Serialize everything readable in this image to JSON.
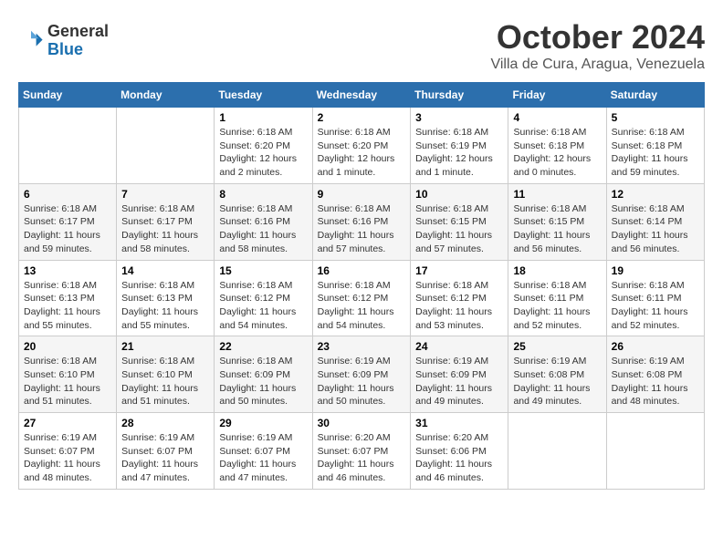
{
  "header": {
    "logo": {
      "general": "General",
      "blue": "Blue"
    },
    "title": "October 2024",
    "location": "Villa de Cura, Aragua, Venezuela"
  },
  "weekdays": [
    "Sunday",
    "Monday",
    "Tuesday",
    "Wednesday",
    "Thursday",
    "Friday",
    "Saturday"
  ],
  "weeks": [
    [
      {
        "day": "",
        "info": ""
      },
      {
        "day": "",
        "info": ""
      },
      {
        "day": "1",
        "info": "Sunrise: 6:18 AM\nSunset: 6:20 PM\nDaylight: 12 hours\nand 2 minutes."
      },
      {
        "day": "2",
        "info": "Sunrise: 6:18 AM\nSunset: 6:20 PM\nDaylight: 12 hours\nand 1 minute."
      },
      {
        "day": "3",
        "info": "Sunrise: 6:18 AM\nSunset: 6:19 PM\nDaylight: 12 hours\nand 1 minute."
      },
      {
        "day": "4",
        "info": "Sunrise: 6:18 AM\nSunset: 6:18 PM\nDaylight: 12 hours\nand 0 minutes."
      },
      {
        "day": "5",
        "info": "Sunrise: 6:18 AM\nSunset: 6:18 PM\nDaylight: 11 hours\nand 59 minutes."
      }
    ],
    [
      {
        "day": "6",
        "info": "Sunrise: 6:18 AM\nSunset: 6:17 PM\nDaylight: 11 hours\nand 59 minutes."
      },
      {
        "day": "7",
        "info": "Sunrise: 6:18 AM\nSunset: 6:17 PM\nDaylight: 11 hours\nand 58 minutes."
      },
      {
        "day": "8",
        "info": "Sunrise: 6:18 AM\nSunset: 6:16 PM\nDaylight: 11 hours\nand 58 minutes."
      },
      {
        "day": "9",
        "info": "Sunrise: 6:18 AM\nSunset: 6:16 PM\nDaylight: 11 hours\nand 57 minutes."
      },
      {
        "day": "10",
        "info": "Sunrise: 6:18 AM\nSunset: 6:15 PM\nDaylight: 11 hours\nand 57 minutes."
      },
      {
        "day": "11",
        "info": "Sunrise: 6:18 AM\nSunset: 6:15 PM\nDaylight: 11 hours\nand 56 minutes."
      },
      {
        "day": "12",
        "info": "Sunrise: 6:18 AM\nSunset: 6:14 PM\nDaylight: 11 hours\nand 56 minutes."
      }
    ],
    [
      {
        "day": "13",
        "info": "Sunrise: 6:18 AM\nSunset: 6:13 PM\nDaylight: 11 hours\nand 55 minutes."
      },
      {
        "day": "14",
        "info": "Sunrise: 6:18 AM\nSunset: 6:13 PM\nDaylight: 11 hours\nand 55 minutes."
      },
      {
        "day": "15",
        "info": "Sunrise: 6:18 AM\nSunset: 6:12 PM\nDaylight: 11 hours\nand 54 minutes."
      },
      {
        "day": "16",
        "info": "Sunrise: 6:18 AM\nSunset: 6:12 PM\nDaylight: 11 hours\nand 54 minutes."
      },
      {
        "day": "17",
        "info": "Sunrise: 6:18 AM\nSunset: 6:12 PM\nDaylight: 11 hours\nand 53 minutes."
      },
      {
        "day": "18",
        "info": "Sunrise: 6:18 AM\nSunset: 6:11 PM\nDaylight: 11 hours\nand 52 minutes."
      },
      {
        "day": "19",
        "info": "Sunrise: 6:18 AM\nSunset: 6:11 PM\nDaylight: 11 hours\nand 52 minutes."
      }
    ],
    [
      {
        "day": "20",
        "info": "Sunrise: 6:18 AM\nSunset: 6:10 PM\nDaylight: 11 hours\nand 51 minutes."
      },
      {
        "day": "21",
        "info": "Sunrise: 6:18 AM\nSunset: 6:10 PM\nDaylight: 11 hours\nand 51 minutes."
      },
      {
        "day": "22",
        "info": "Sunrise: 6:18 AM\nSunset: 6:09 PM\nDaylight: 11 hours\nand 50 minutes."
      },
      {
        "day": "23",
        "info": "Sunrise: 6:19 AM\nSunset: 6:09 PM\nDaylight: 11 hours\nand 50 minutes."
      },
      {
        "day": "24",
        "info": "Sunrise: 6:19 AM\nSunset: 6:09 PM\nDaylight: 11 hours\nand 49 minutes."
      },
      {
        "day": "25",
        "info": "Sunrise: 6:19 AM\nSunset: 6:08 PM\nDaylight: 11 hours\nand 49 minutes."
      },
      {
        "day": "26",
        "info": "Sunrise: 6:19 AM\nSunset: 6:08 PM\nDaylight: 11 hours\nand 48 minutes."
      }
    ],
    [
      {
        "day": "27",
        "info": "Sunrise: 6:19 AM\nSunset: 6:07 PM\nDaylight: 11 hours\nand 48 minutes."
      },
      {
        "day": "28",
        "info": "Sunrise: 6:19 AM\nSunset: 6:07 PM\nDaylight: 11 hours\nand 47 minutes."
      },
      {
        "day": "29",
        "info": "Sunrise: 6:19 AM\nSunset: 6:07 PM\nDaylight: 11 hours\nand 47 minutes."
      },
      {
        "day": "30",
        "info": "Sunrise: 6:20 AM\nSunset: 6:07 PM\nDaylight: 11 hours\nand 46 minutes."
      },
      {
        "day": "31",
        "info": "Sunrise: 6:20 AM\nSunset: 6:06 PM\nDaylight: 11 hours\nand 46 minutes."
      },
      {
        "day": "",
        "info": ""
      },
      {
        "day": "",
        "info": ""
      }
    ]
  ]
}
